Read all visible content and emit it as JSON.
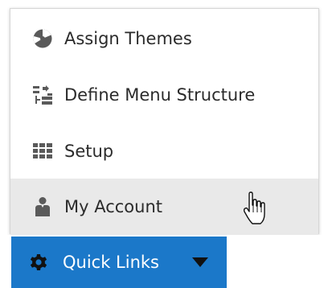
{
  "menu": {
    "items": [
      {
        "label": "Assign Themes",
        "icon": "palette-icon"
      },
      {
        "label": "Define Menu Structure",
        "icon": "structure-icon"
      },
      {
        "label": "Setup",
        "icon": "grid-icon"
      },
      {
        "label": "My Account",
        "icon": "user-icon",
        "hovered": true
      }
    ]
  },
  "quick_links": {
    "label": "Quick Links",
    "icon": "gear-icon",
    "caret_icon": "caret-down-icon"
  },
  "colors": {
    "accent": "#1b78c9",
    "icon": "#5a5a5a",
    "hover_bg": "#e9e9e9",
    "text": "#2b2b2b"
  }
}
